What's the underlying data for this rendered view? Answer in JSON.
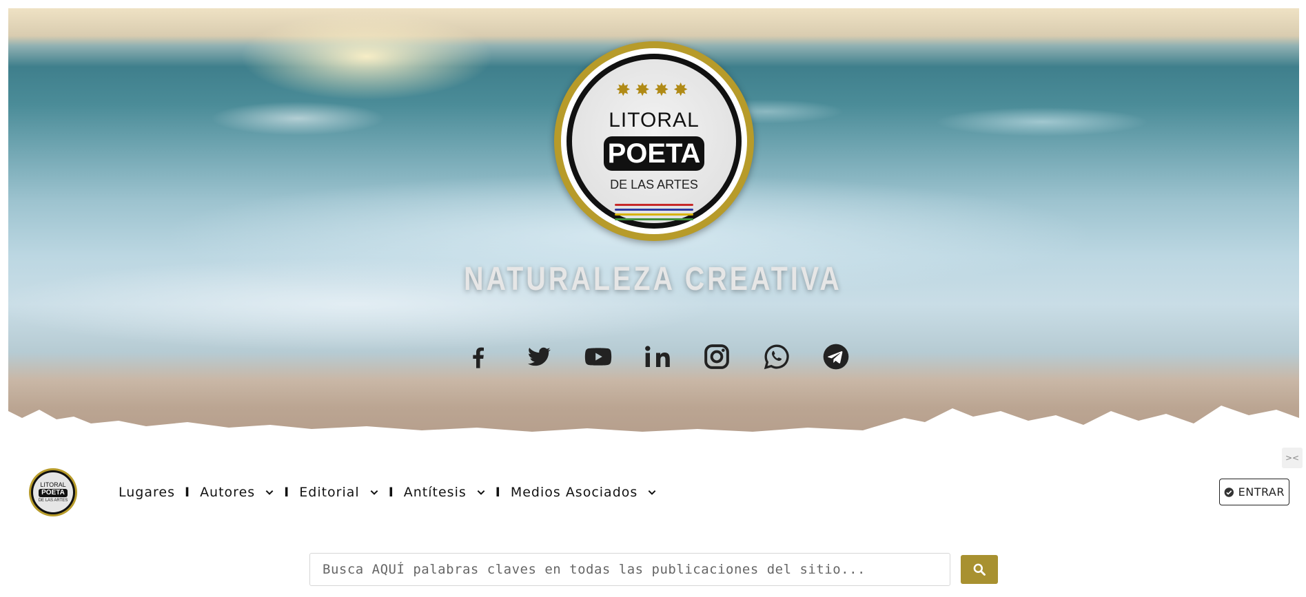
{
  "hero": {
    "logo": {
      "top": "LITORAL",
      "middle": "POETA",
      "bottom": "DE LAS ARTES",
      "stars": "✸✸✸✸"
    },
    "tagline": "NATURALEZA CREATIVA",
    "social": [
      {
        "name": "facebook-icon"
      },
      {
        "name": "twitter-icon"
      },
      {
        "name": "youtube-icon"
      },
      {
        "name": "linkedin-icon"
      },
      {
        "name": "instagram-icon"
      },
      {
        "name": "whatsapp-icon"
      },
      {
        "name": "telegram-icon"
      }
    ]
  },
  "nav": {
    "logo": {
      "top": "LITORAL",
      "middle": "POETA",
      "bottom": "DE LAS ARTES"
    },
    "items": [
      {
        "label": "Lugares",
        "dropdown": false
      },
      {
        "label": "Autores",
        "dropdown": true
      },
      {
        "label": "Editorial",
        "dropdown": true
      },
      {
        "label": "Antítesis",
        "dropdown": true
      },
      {
        "label": "Medios Asociados",
        "dropdown": true
      }
    ],
    "separator": "I",
    "login_label": "ENTRAR"
  },
  "search": {
    "placeholder": "Busca AQUÍ palabras claves en todas las publicaciones del sitio..."
  },
  "colors": {
    "gold": "#b79b2a",
    "search_button": "#a89130",
    "text": "#111111"
  }
}
